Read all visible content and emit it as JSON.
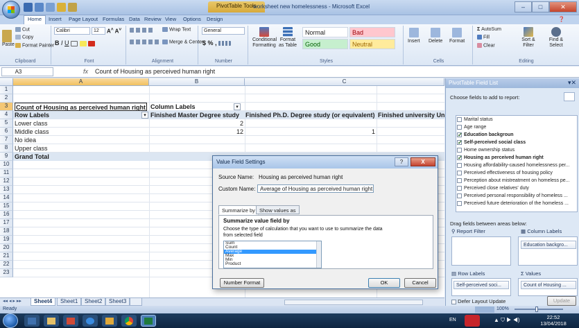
{
  "window": {
    "title": "worksheet new homelessness - Microsoft Excel",
    "contextual_tab": "PivotTable Tools",
    "minimize": "–",
    "maximize": "□",
    "close": "✕"
  },
  "ribbon_tabs": [
    "Home",
    "Insert",
    "Page Layout",
    "Formulas",
    "Data",
    "Review",
    "View",
    "Options",
    "Design"
  ],
  "ribbon": {
    "clipboard": {
      "label": "Clipboard",
      "paste": "Paste",
      "cut": "Cut",
      "copy": "Copy",
      "format_painter": "Format Painter"
    },
    "font": {
      "label": "Font",
      "family": "Calibri",
      "size": "12"
    },
    "alignment": {
      "label": "Alignment",
      "wrap": "Wrap Text",
      "merge": "Merge & Center"
    },
    "number": {
      "label": "Number",
      "format": "General",
      "currency": "$",
      "percent": "%",
      "comma": ","
    },
    "styles": {
      "label": "Styles",
      "conditional": "Conditional Formatting",
      "format_table": "Format as Table",
      "normal": "Normal",
      "bad": "Bad",
      "good": "Good",
      "neutral": "Neutral"
    },
    "cells": {
      "label": "Cells",
      "insert": "Insert",
      "delete": "Delete",
      "format": "Format"
    },
    "editing": {
      "label": "Editing",
      "autosum": "AutoSum",
      "fill": "Fill",
      "clear": "Clear",
      "sort": "Sort & Filter",
      "find": "Find & Select"
    }
  },
  "formula_bar": {
    "name_box": "A3",
    "fx": "fx",
    "formula": "Count of Housing as perceived human right"
  },
  "columns": [
    "A",
    "B",
    "C"
  ],
  "rows": [
    "1",
    "2",
    "3",
    "4",
    "5",
    "6",
    "7",
    "8",
    "9",
    "10",
    "11",
    "12",
    "13",
    "14",
    "15",
    "16",
    "17",
    "18",
    "19",
    "20",
    "21",
    "22",
    "23"
  ],
  "pivot": {
    "header": "Count of Housing as perceived human right",
    "column_labels": "Column Labels",
    "row_labels": "Row Labels",
    "col_headers": [
      "Finished Master Degree study",
      "Finished Ph.D. Degree study (or equivalent)",
      "Finished university Un"
    ],
    "rows": [
      {
        "label": "Lower class",
        "b": "2",
        "c": ""
      },
      {
        "label": "Middle class",
        "b": "12",
        "c": "1"
      },
      {
        "label": "No idea",
        "b": "",
        "c": ""
      },
      {
        "label": "Upper class",
        "b": "",
        "c": ""
      }
    ],
    "grand_total": "Grand Total"
  },
  "sheets": [
    "Sheet4",
    "Sheet1",
    "Sheet2",
    "Sheet3"
  ],
  "status": {
    "ready": "Ready",
    "zoom": "100%"
  },
  "field_list": {
    "title": "PivotTable Field List",
    "choose": "Choose fields to add to report:",
    "fields": [
      {
        "name": "Marital status",
        "checked": false
      },
      {
        "name": "Age range",
        "checked": false
      },
      {
        "name": "Education backgroun",
        "checked": true
      },
      {
        "name": "Self-perceived social class",
        "checked": true
      },
      {
        "name": "Home ownership status",
        "checked": false
      },
      {
        "name": "Housing as perceived human right",
        "checked": true
      },
      {
        "name": "Housing affordability-caused homelessness per...",
        "checked": false
      },
      {
        "name": "Perceived effectiveness of housing policy",
        "checked": false
      },
      {
        "name": "Perception about mistreatment on homeless pe...",
        "checked": false
      },
      {
        "name": "Perceived close relatives' duty",
        "checked": false
      },
      {
        "name": "Perceived personal responsibility of homeless ...",
        "checked": false
      },
      {
        "name": "Perceived future deterioration of the homeless ...",
        "checked": false
      }
    ],
    "drag_label": "Drag fields between areas below:",
    "report_filter": "Report Filter",
    "column_labels": "Column Labels",
    "row_labels": "Row Labels",
    "values": "Values",
    "col_chip": "Education backgro...",
    "row_chip": "Self-perceived soci...",
    "val_chip": "Count of Housing ...",
    "defer": "Defer Layout Update",
    "update": "Update"
  },
  "dialog": {
    "title": "Value Field Settings",
    "help": "?",
    "close": "X",
    "source_label": "Source Name:",
    "source_value": "Housing as perceived human right",
    "custom_label": "Custom Name:",
    "custom_value": "Average of Housing as perceived human right",
    "tab_summarize": "Summarize by",
    "tab_show": "Show values as",
    "section_title": "Summarize value field by",
    "description": "Choose the type of calculation that you want to use to summarize the data from selected field",
    "options": [
      "Sum",
      "Count",
      "Average",
      "Max",
      "Min",
      "Product"
    ],
    "selected": "Average",
    "number_format": "Number Format",
    "ok": "OK",
    "cancel": "Cancel"
  },
  "taskbar": {
    "lang": "EN",
    "time": "22:52",
    "date": "13/04/2018"
  }
}
